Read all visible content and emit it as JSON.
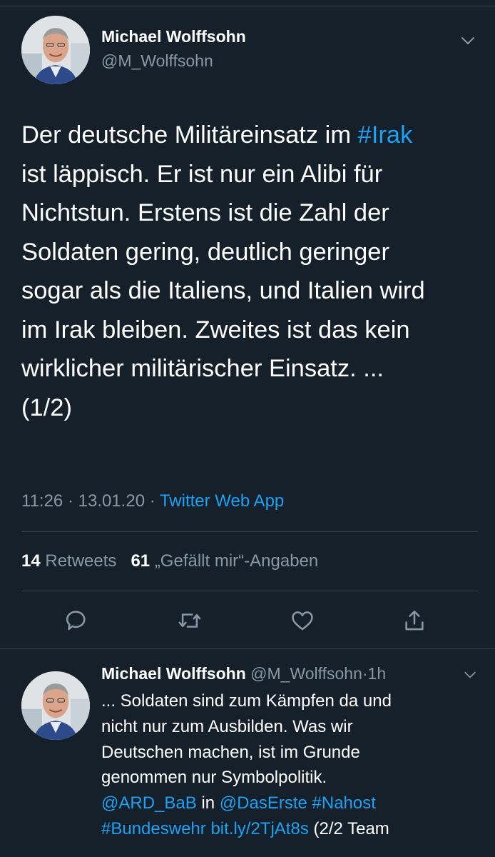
{
  "main_tweet": {
    "author_name": "Michael Wolffsohn",
    "author_handle": "@M_Wolffsohn",
    "text_lines": [
      {
        "before": "Der deutsche Militäreinsatz im ",
        "link": "#Irak"
      },
      {
        "before": "ist läppisch. Er ist nur ein Alibi für"
      },
      {
        "before": "Nichtstun. Erstens ist die Zahl der"
      },
      {
        "before": "Soldaten gering, deutlich geringer"
      },
      {
        "before": "sogar als die Italiens, und Italien wird"
      },
      {
        "before": "im Irak bleiben. Zweites ist das kein"
      },
      {
        "before": "wirklicher militärischer Einsatz. ..."
      },
      {
        "before": "(1/2)"
      }
    ],
    "time": "11:26",
    "date": "13.01.20",
    "separator": "·",
    "source": "Twitter Web App",
    "retweet_count": "14",
    "retweet_label": "Retweets",
    "like_count": "61",
    "like_label": "„Gefällt mir“-Angaben"
  },
  "actions": [
    {
      "icon": "reply-icon"
    },
    {
      "icon": "retweet-icon"
    },
    {
      "icon": "like-icon"
    },
    {
      "icon": "share-icon"
    }
  ],
  "reply_tweet": {
    "author_name": "Michael Wolffsohn",
    "author_handle": "@M_Wolffsohn",
    "separator": "·",
    "age": "1h",
    "text_lines": [
      "... Soldaten sind zum Kämpfen da und",
      "nicht nur zum Ausbilden. Was wir",
      "Deutschen machen, ist im Grunde",
      "genommen nur Symbolpolitik."
    ],
    "mention_1": "@ARD_BaB",
    "word_in": "in",
    "mention_2": "@DasErste",
    "hashtag_1": "#Nahost",
    "hashtag_2": "#Bundeswehr",
    "link": "bit.ly/2TjAt8s",
    "trailing": "(2/2 Team"
  },
  "colors": {
    "background": "#15202b",
    "text": "#ffffff",
    "secondary": "#8899a6",
    "accent": "#1da1f2",
    "divider": "#38444d"
  }
}
